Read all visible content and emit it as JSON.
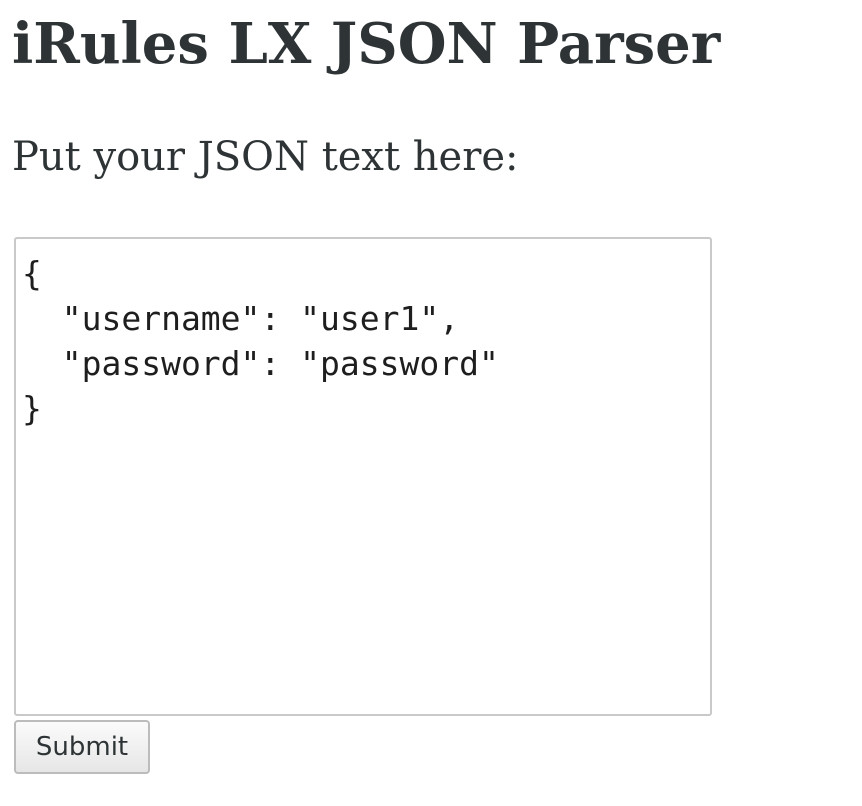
{
  "page": {
    "title": "iRules LX JSON Parser",
    "prompt": "Put your JSON text here:"
  },
  "form": {
    "json_text": "{\n  \"username\": \"user1\",\n  \"password\": \"password\"\n}",
    "submit_label": "Submit"
  }
}
